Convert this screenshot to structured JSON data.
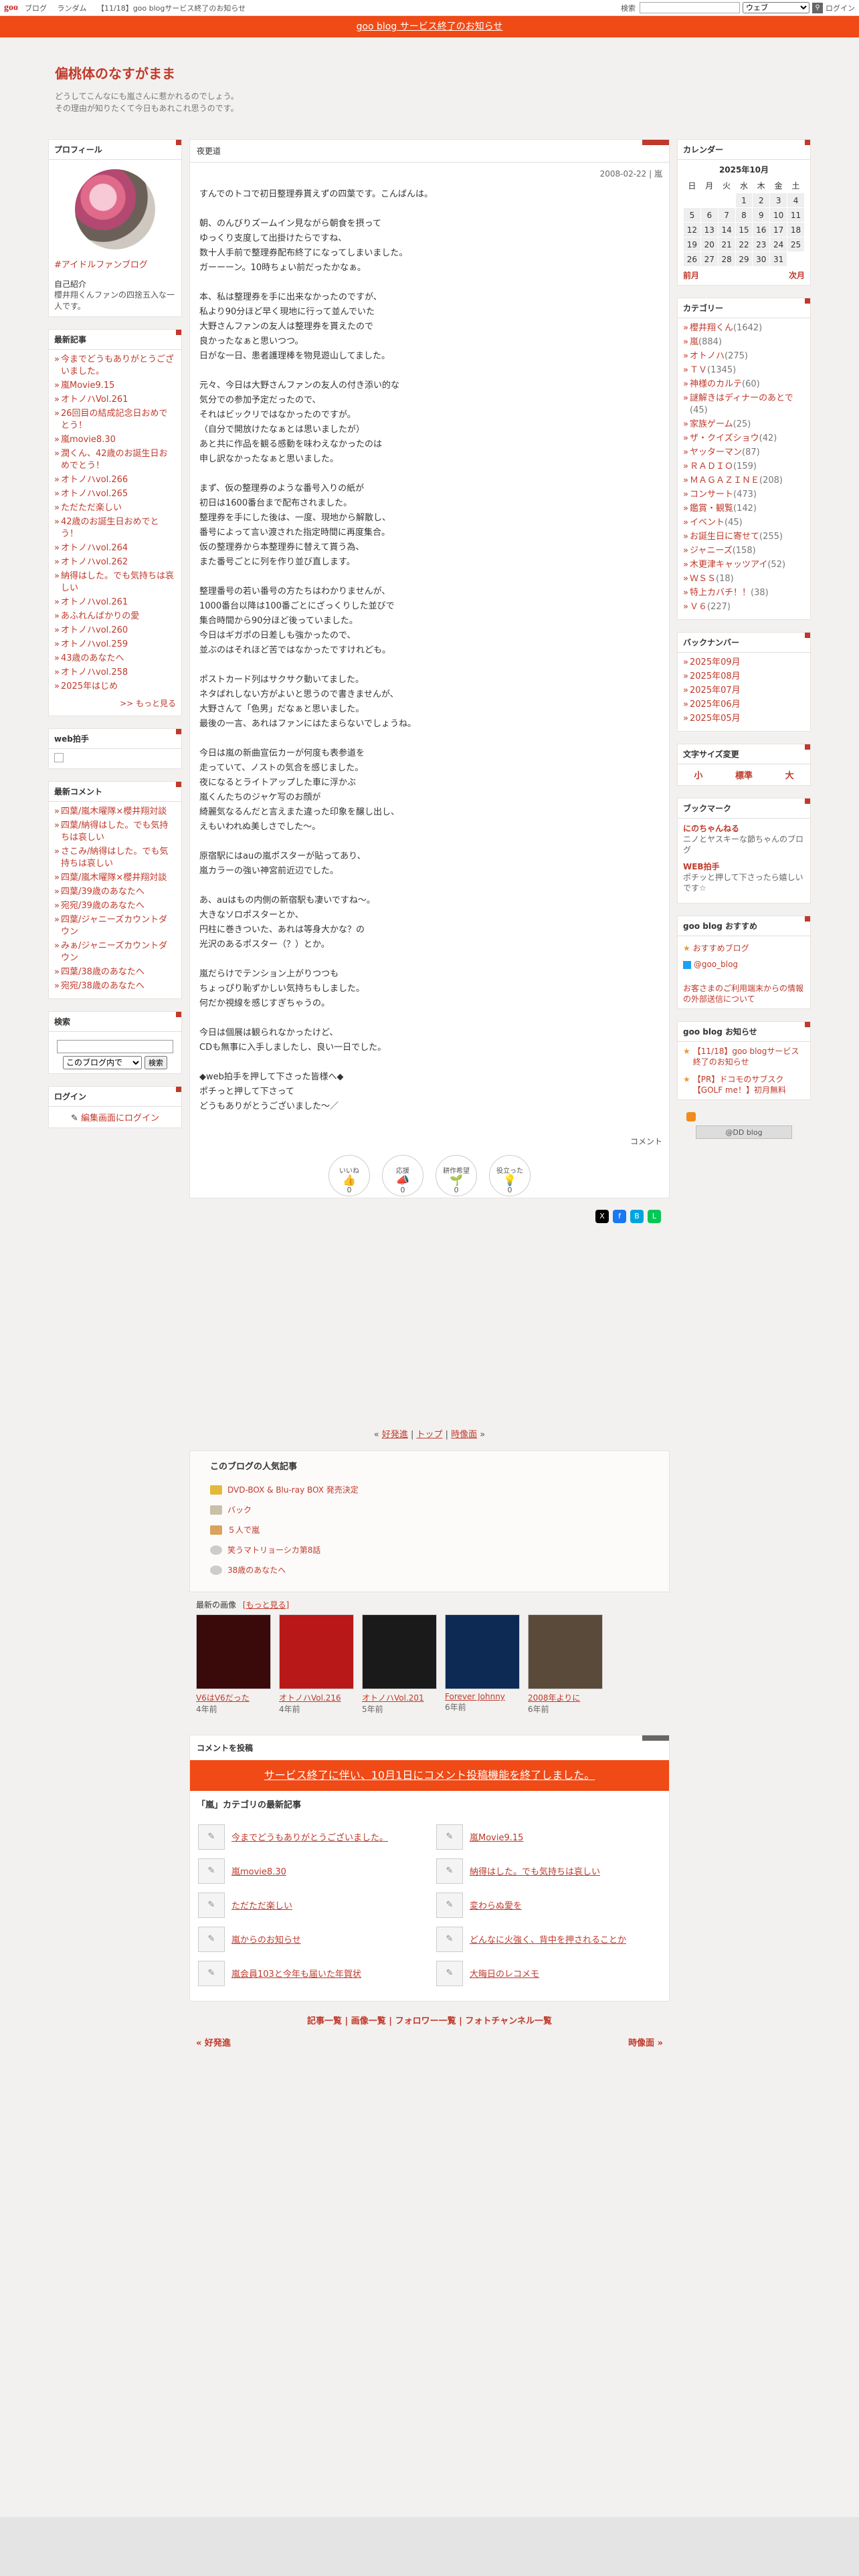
{
  "gbar": {
    "logo": "goo",
    "nav": [
      "ブログ",
      "ランダム",
      "【11/18】goo blogサービス終了のお知らせ"
    ],
    "search_label": "検索",
    "search_select": "ウェブ",
    "login": "ログイン"
  },
  "notice": "goo blog サービス終了のお知らせ",
  "header": {
    "title": "偏桃体のなすがまま",
    "desc1": "どうしてこんなにも嵐さんに惹かれるのでしょう。",
    "desc2": "その理由が知りたくて今日もあれこれ思うのです。"
  },
  "profile": {
    "title": "プロフィール",
    "link": "#アイドルファンブログ",
    "intro_label": "自己紹介",
    "intro": "櫻井翔くんファンの四捨五入な一人です。"
  },
  "recent": {
    "title": "最新記事",
    "items": [
      "今までどうもありがとうございました。",
      "嵐Movie9.15",
      "オトノハVol.261",
      "26回目の結成記念日おめでとう！",
      "嵐movie8.30",
      "潤くん、42歳のお誕生日おめでとう！",
      "オトノハvol.266",
      "オトノハvol.265",
      "ただただ楽しい",
      "42歳のお誕生日おめでとう！",
      "オトノハvol.264",
      "オトノハvol.262",
      "納得はした。でも気持ちは哀しい",
      "オトノハvol.261",
      "あふれんばかりの愛",
      "オトノハvol.260",
      "オトノハvol.259",
      "43歳のあなたへ",
      "オトノハvol.258",
      "2025年はじめ"
    ],
    "more": ">> もっと見る"
  },
  "webclap": {
    "title": "web拍手"
  },
  "comments": {
    "title": "最新コメント",
    "items": [
      "四葉/嵐木曜隊×櫻井翔対談",
      "四葉/納得はした。でも気持ちは哀しい",
      "さこみ/納得はした。でも気持ちは哀しい",
      "四葉/嵐木曜隊×櫻井翔対談",
      "四葉/39歳のあなたへ",
      "宛宛/39歳のあなたへ",
      "四葉/ジャニーズカウントダウン",
      "みぁ/ジャニーズカウントダウン",
      "四葉/38歳のあなたへ",
      "宛宛/38歳のあなたへ"
    ]
  },
  "search": {
    "title": "検索",
    "scope": "このブログ内で",
    "button": "検索"
  },
  "login": {
    "title": "ログイン",
    "link": "編集画面にログイン"
  },
  "article": {
    "category_title": "夜更道",
    "meta": "2008-02-22 | 嵐",
    "paragraphs": [
      "すんでのトコで初日整理券貰えずの四葉です。こんばんは。",
      "朝、のんびりズームイン見ながら朝食を摂って\nゆっくり支度して出掛けたらですね、\n数十人手前で整理券配布終了になってしまいました。\nガーーーン。10時ちょい前だったかなぁ。",
      "本、私は整理券を手に出来なかったのですが、\n私より90分ほど早く現地に行って並んでいた\n大野さんファンの友人は整理券を貰えたので\n良かったなぁと思いつつ。\n日がな一日、患者護理棒を物見遊山してました。",
      "元々、今日は大野さんファンの友人の付き添い的な\n気分での参加予定だったので、\nそれはビックリではなかったのですが。\n（自分で開放けたなぁとは思いましたが）\nあと共に作品を観る感動を味わえなかったのは\n申し訳なかったなぁと思いました。",
      "まず、仮の整理券のような番号入りの紙が\n初日は1600番台まで配布されました。\n整理券を手にした後は、一度、現地から解散し、\n番号によって言い渡された指定時間に再度集合。\n仮の整理券から本整理券に替えて貰う為、\nまた番号ごとに列を作り並び直します。",
      "整理番号の若い番号の方たちはわかりませんが、\n1000番台以降は100番ごとにざっくりした並びで\n集合時間から90分ほど後っていました。\n今日はギガポの日差しも強かったので、\n並ぶのはそれほど苦ではなかったですけれども。",
      "ポストカード列はサクサク動いてました。\nネタばれしない方がよいと思うので書きませんが、\n大野さんて「色男」だなぁと思いました。\n最後の一言、あれはファンにはたまらないでしょうね。",
      "今日は嵐の新曲宣伝カーが何度も表参道を\n走っていて、ノストの気合を感じました。\n夜になるとライトアップした車に浮かぶ\n嵐くんたちのジャケ写のお顔が\n綺麗気なるんだと言えまた違った印象を醸し出し、\nえもいわれぬ美しさでした～。",
      "原宿駅にはauの嵐ポスターが貼ってあり、\n嵐カラーの強い神宮前近辺でした。",
      "あ、auはもの内側の新宿駅も凄いですね～。\n大きなソロポスターとか、\n円柱に巻きついた、あれは等身大かな？の\n光沢のあるポスター（？）とか。",
      "嵐だらけでテンション上がりつつも\nちょっぴり恥ずかしい気持ちもしました。\n何だか視線を感じすぎちゃうの。",
      "今日は個展は観られなかったけど、\nCDも無事に入手しましたし、良い一日でした。",
      "◆web拍手を押して下さった皆様へ◆\nポチっと押して下さって\nどうもありがとうございました～／"
    ],
    "comment_link": "コメント",
    "reactions": [
      {
        "label": "いいね",
        "count": "0"
      },
      {
        "label": "応援",
        "count": "0"
      },
      {
        "label": "耕作希望",
        "count": "0"
      },
      {
        "label": "役立った",
        "count": "0"
      }
    ]
  },
  "blog_nav": {
    "prev": "好発進",
    "top": "トップ",
    "next": "時像面"
  },
  "popular": {
    "title": "このブログの人気記事",
    "items": [
      "DVD-BOX & Blu-ray BOX 発売決定",
      "バック",
      "５人で嵐",
      "笑うマトリョーシカ第8話",
      "38歳のあなたへ"
    ]
  },
  "images": {
    "title": "最新の画像",
    "more": "[もっと見る]",
    "items": [
      {
        "caption": "V6はV6だった",
        "age": "4年前"
      },
      {
        "caption": "オトノハVol.216",
        "age": "4年前"
      },
      {
        "caption": "オトノハVol.201",
        "age": "5年前"
      },
      {
        "caption": "Forever Johnny",
        "age": "6年前"
      },
      {
        "caption": "2008年よりに",
        "age": "6年前"
      }
    ]
  },
  "comment_post": {
    "title": "コメントを投稿",
    "banner": "サービス終了に伴い、10月1日にコメント投稿機能を終了しました。"
  },
  "category_latest": {
    "title": "「嵐」カテゴリの最新記事",
    "items": [
      "今までどうもありがとうございました。",
      "嵐Movie9.15",
      "嵐movie8.30",
      "納得はした。でも気持ちは哀しい",
      "ただただ楽しい",
      "変わらぬ愛を",
      "嵐からのお知らせ",
      "どんなに火強く、背中を押されることか",
      "嵐会員103と今年も届いた年賀状",
      "大晦日のレコメモ"
    ]
  },
  "footer": {
    "links": [
      "記事一覧",
      "画像一覧",
      "フォロワー一覧",
      "フォトチャンネル一覧"
    ],
    "prev": "« 好発進",
    "next": "時像面 »"
  },
  "calendar": {
    "title": "カレンダー",
    "month": "2025年10月",
    "weekdays": [
      "日",
      "月",
      "火",
      "水",
      "木",
      "金",
      "土"
    ],
    "rows": [
      [
        "",
        "",
        "",
        "1",
        "2",
        "3",
        "4"
      ],
      [
        "5",
        "6",
        "7",
        "8",
        "9",
        "10",
        "11"
      ],
      [
        "12",
        "13",
        "14",
        "15",
        "16",
        "17",
        "18"
      ],
      [
        "19",
        "20",
        "21",
        "22",
        "23",
        "24",
        "25"
      ],
      [
        "26",
        "27",
        "28",
        "29",
        "30",
        "31",
        ""
      ]
    ],
    "prev": "前月",
    "next": "次月"
  },
  "categories": {
    "title": "カテゴリー",
    "items": [
      {
        "name": "櫻井翔くん",
        "count": "(1642)"
      },
      {
        "name": "嵐",
        "count": "(884)"
      },
      {
        "name": "オトノハ",
        "count": "(275)"
      },
      {
        "name": "ＴＶ",
        "count": "(1345)"
      },
      {
        "name": "神様のカルテ",
        "count": "(60)"
      },
      {
        "name": "謎解きはディナーのあとで",
        "count": "(45)"
      },
      {
        "name": "家族ゲーム",
        "count": "(25)"
      },
      {
        "name": "ザ・クイズショウ",
        "count": "(42)"
      },
      {
        "name": "ヤッターマン",
        "count": "(87)"
      },
      {
        "name": "ＲＡＤＩＯ",
        "count": "(159)"
      },
      {
        "name": "ＭＡＧＡＺＩＮＥ",
        "count": "(208)"
      },
      {
        "name": "コンサート",
        "count": "(473)"
      },
      {
        "name": "鑑賞・観覧",
        "count": "(142)"
      },
      {
        "name": "イベント",
        "count": "(45)"
      },
      {
        "name": "お誕生日に寄せて",
        "count": "(255)"
      },
      {
        "name": "ジャニーズ",
        "count": "(158)"
      },
      {
        "name": "木更津キャッツアイ",
        "count": "(52)"
      },
      {
        "name": "ＷＳＳ",
        "count": "(18)"
      },
      {
        "name": "特上カバチ！！",
        "count": "(38)"
      },
      {
        "name": "Ｖ６",
        "count": "(227)"
      }
    ]
  },
  "backnumber": {
    "title": "バックナンバー",
    "items": [
      "2025年09月",
      "2025年08月",
      "2025年07月",
      "2025年06月",
      "2025年05月"
    ]
  },
  "fontsize": {
    "title": "文字サイズ変更",
    "small": "小",
    "normal": "標準",
    "large": "大"
  },
  "bookmark": {
    "title": "ブックマーク",
    "items": [
      {
        "name": "にのちゃんねる",
        "desc": "ニノとヤスキーな節ちゃんのブログ"
      },
      {
        "name": "WEB拍手",
        "desc": "ポチッと押して下さったら嬉しいです☆"
      }
    ]
  },
  "goo_recommend": {
    "title": "goo blog おすすめ",
    "items": [
      "おすすめブログ",
      "@goo_blog"
    ],
    "notice": "お客さまのご利用端末からの情報の外部送信について"
  },
  "goo_notice": {
    "title": "goo blog お知らせ",
    "items": [
      "【11/18】goo blogサービス終了のお知らせ",
      "【PR】ドコモのサブスク【GOLF me！】初月無料"
    ],
    "badge": "@DD blog"
  }
}
